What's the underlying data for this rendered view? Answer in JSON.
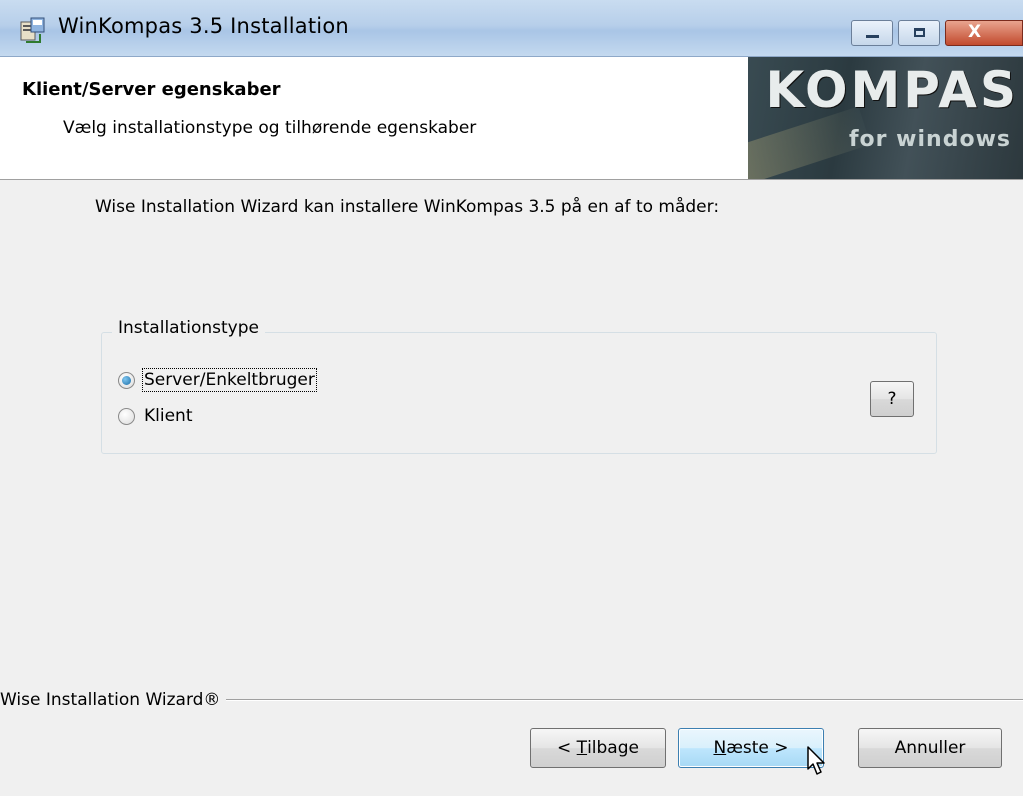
{
  "window": {
    "title": "WinKompas 3.5 Installation",
    "close_glyph": "X"
  },
  "header": {
    "title": "Klient/Server egenskaber",
    "subtitle": "Vælg installationstype og tilhørende egenskaber",
    "logo_main": "KOMPAS",
    "logo_sub": "for windows"
  },
  "main": {
    "intro": "Wise Installation Wizard kan installere WinKompas 3.5 på en af to måder:",
    "group_label": "Installationstype",
    "options": [
      {
        "label": "Server/Enkeltbruger",
        "selected": true
      },
      {
        "label": "Klient",
        "selected": false
      }
    ],
    "help_label": "?"
  },
  "footer": {
    "brand": "Wise Installation Wizard®",
    "back_prefix": "< ",
    "back_mnemonic": "T",
    "back_rest": "ilbage",
    "next_mnemonic": "N",
    "next_rest": "æste >",
    "cancel_label": "Annuller"
  },
  "colors": {
    "titlebar": "#b7cfea",
    "dialog_bg": "#f0f0f0",
    "header_bg": "#ffffff",
    "default_button_border": "#3c7fb1"
  },
  "icons": [
    "installer-icon",
    "minimize-icon",
    "maximize-icon",
    "close-icon",
    "radio-checked",
    "radio-unchecked",
    "mouse-pointer-icon"
  ]
}
